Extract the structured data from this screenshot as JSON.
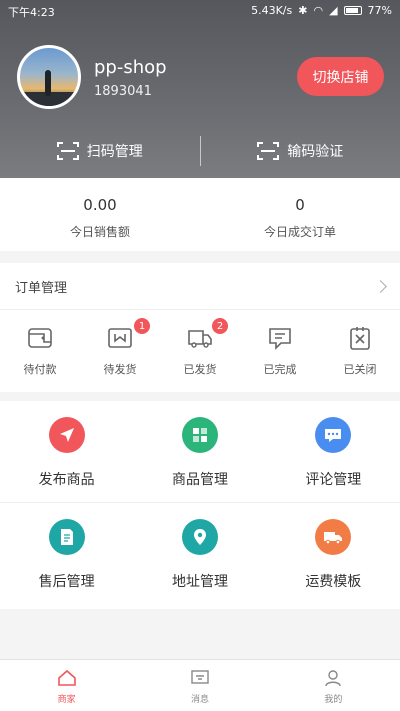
{
  "status_bar": {
    "time": "下午4:23",
    "speed": "5.43K/s",
    "battery": "77%"
  },
  "shop": {
    "name": "pp-shop",
    "id": "1893041",
    "switch_label": "切换店铺"
  },
  "header_actions": {
    "scan": "扫码管理",
    "code_verify": "输码验证"
  },
  "stats": {
    "sales": {
      "value": "0.00",
      "label": "今日销售额"
    },
    "orders": {
      "value": "0",
      "label": "今日成交订单"
    }
  },
  "orders": {
    "title": "订单管理",
    "items": [
      {
        "label": "待付款",
        "icon": "wallet-icon",
        "badge": null
      },
      {
        "label": "待发货",
        "icon": "box-icon",
        "badge": "1"
      },
      {
        "label": "已发货",
        "icon": "truck-icon",
        "badge": "2"
      },
      {
        "label": "已完成",
        "icon": "comment-icon",
        "badge": null
      },
      {
        "label": "已关闭",
        "icon": "closed-icon",
        "badge": null
      }
    ]
  },
  "grid": [
    {
      "label": "发布商品",
      "icon": "send-icon",
      "color": "#f0565a"
    },
    {
      "label": "商品管理",
      "icon": "goods-icon",
      "color": "#2bb57a"
    },
    {
      "label": "评论管理",
      "icon": "chat-icon",
      "color": "#4a8df0"
    },
    {
      "label": "售后管理",
      "icon": "document-icon",
      "color": "#1fa7a5"
    },
    {
      "label": "地址管理",
      "icon": "location-icon",
      "color": "#1fa7a5"
    },
    {
      "label": "运费模板",
      "icon": "delivery-icon",
      "color": "#f27c45"
    }
  ],
  "bottom_nav": [
    {
      "label": "商家",
      "icon": "home-icon",
      "active": true
    },
    {
      "label": "消息",
      "icon": "message-icon",
      "active": false
    },
    {
      "label": "我的",
      "icon": "profile-icon",
      "active": false
    }
  ],
  "colors": {
    "accent": "#f0565a"
  }
}
